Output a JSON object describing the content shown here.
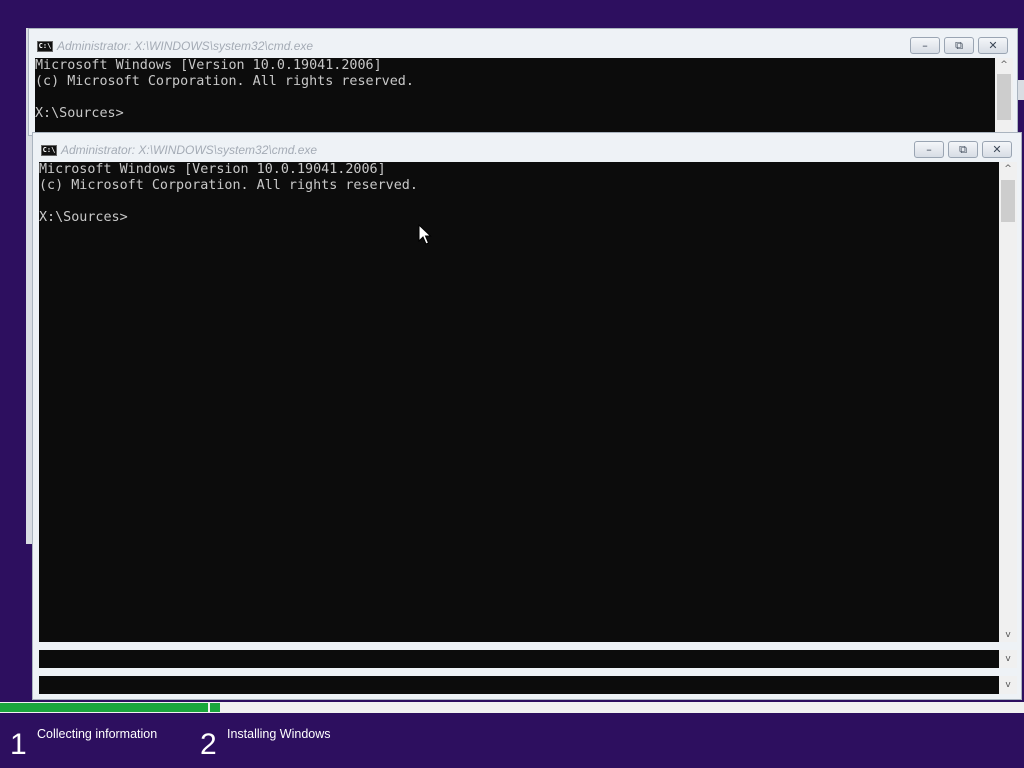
{
  "colors": {
    "background": "#2d0f5f",
    "console_bg": "#0c0c0c",
    "console_text": "#c8c8c8",
    "progress": "#1ba63d"
  },
  "back_window": {
    "title": "Administrator: X:\\WINDOWS\\system32\\cmd.exe",
    "icon_label": "C:\\",
    "lines": [
      "Microsoft Windows [Version 10.0.19041.2006]",
      "(c) Microsoft Corporation. All rights reserved.",
      "",
      "X:\\Sources>"
    ],
    "minimize": "–",
    "maximize": "⧉",
    "close": "✕"
  },
  "front_window": {
    "title": "Administrator: X:\\WINDOWS\\system32\\cmd.exe",
    "icon_label": "C:\\",
    "lines": [
      "Microsoft Windows [Version 10.0.19041.2006]",
      "(c) Microsoft Corporation. All rights reserved.",
      "",
      "X:\\Sources>"
    ],
    "minimize": "–",
    "maximize": "⧉",
    "close": "✕"
  },
  "setup": {
    "progress_fraction": 0.21,
    "steps": [
      {
        "number": "1",
        "label": "Collecting information"
      },
      {
        "number": "2",
        "label": "Installing Windows"
      }
    ]
  },
  "icons": {
    "scroll_up": "^",
    "scroll_down": "v",
    "cursor": "arrow-cursor-icon"
  }
}
